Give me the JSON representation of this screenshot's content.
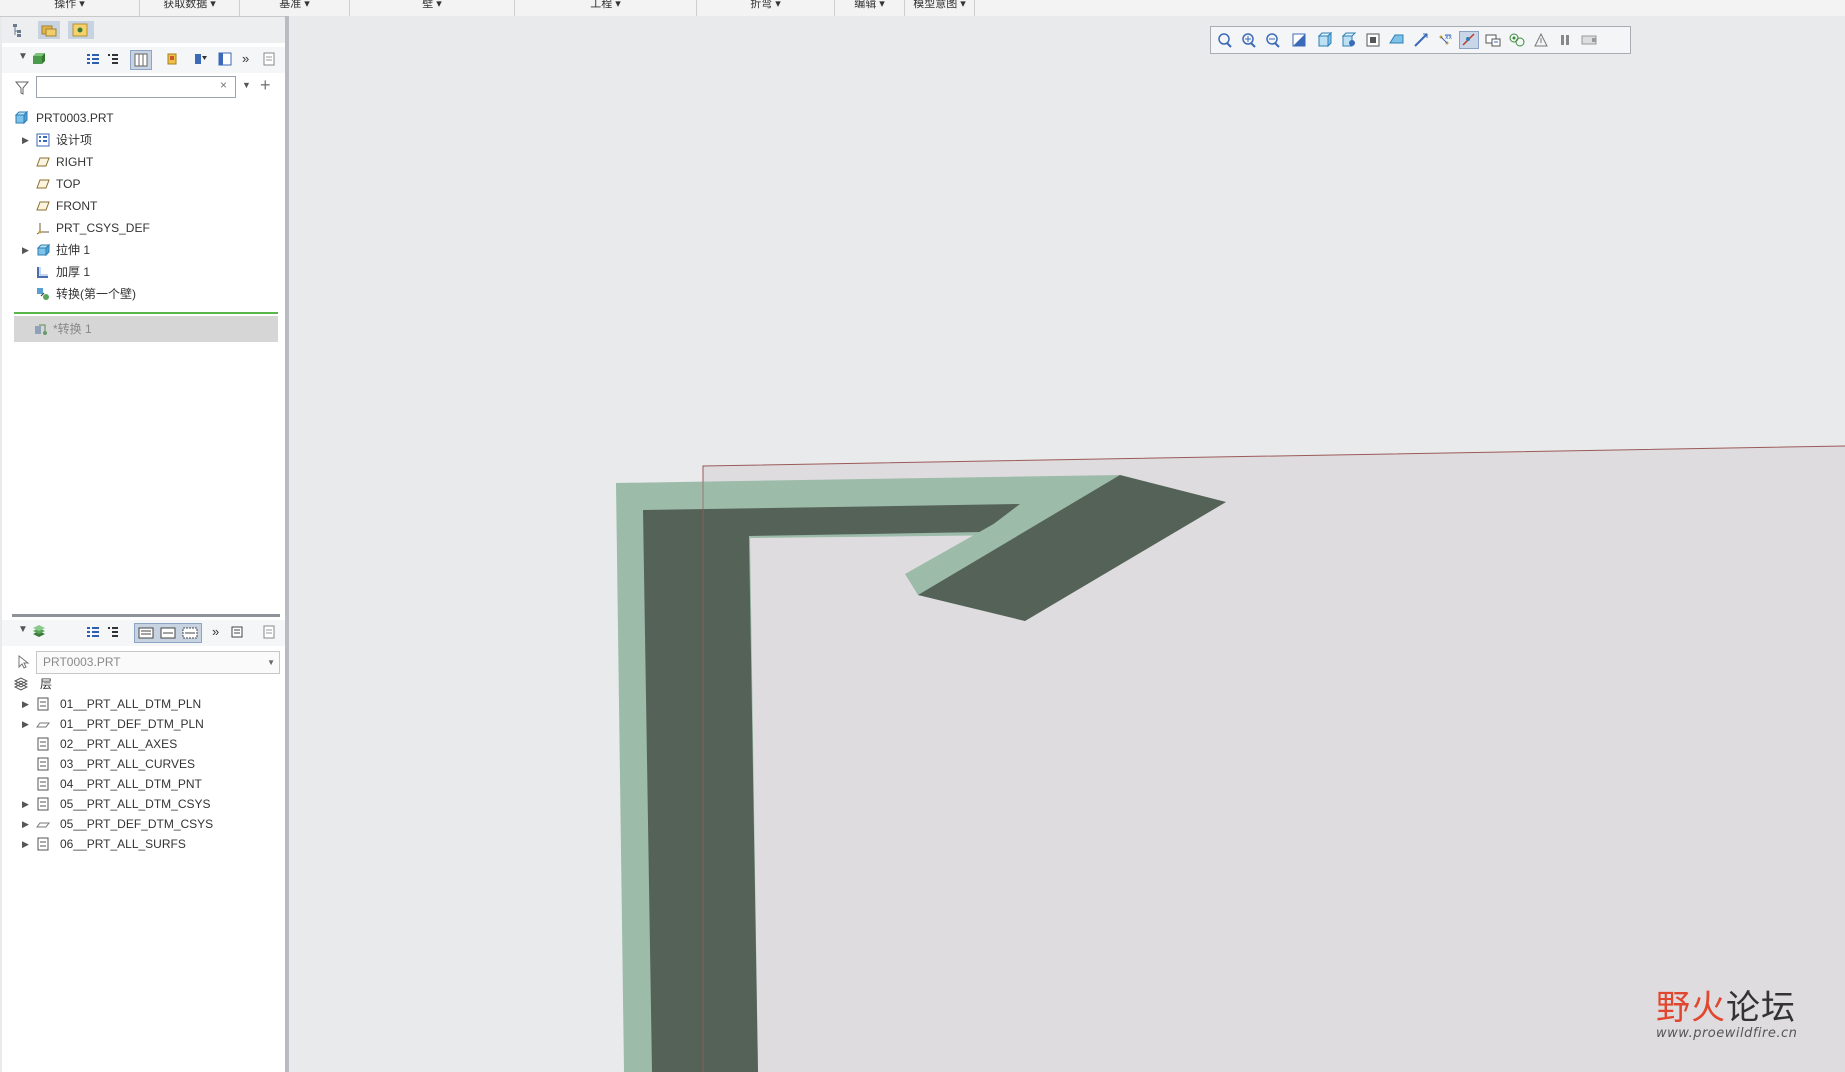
{
  "menu_groups": [
    "操作",
    "获取数据",
    "基准",
    "壁",
    "工程",
    "折弯",
    "编辑",
    "模型意图"
  ],
  "model_tree": {
    "filter_placeholder": "",
    "root": "PRT0003.PRT",
    "items": [
      {
        "label": "设计项",
        "expandable": true,
        "icon": "design-items-icon"
      },
      {
        "label": "RIGHT",
        "expandable": false,
        "icon": "datum-plane-icon"
      },
      {
        "label": "TOP",
        "expandable": false,
        "icon": "datum-plane-icon"
      },
      {
        "label": "FRONT",
        "expandable": false,
        "icon": "datum-plane-icon"
      },
      {
        "label": "PRT_CSYS_DEF",
        "expandable": false,
        "icon": "csys-icon"
      },
      {
        "label": "拉伸 1",
        "expandable": true,
        "icon": "extrude-icon"
      },
      {
        "label": "加厚 1",
        "expandable": false,
        "icon": "thicken-icon"
      },
      {
        "label": "转换(第一个壁)",
        "expandable": false,
        "icon": "convert-icon"
      }
    ],
    "inserted_feature": "转换 1"
  },
  "layer_tree": {
    "model": "PRT0003.PRT",
    "header": "层",
    "items": [
      {
        "label": "01__PRT_ALL_DTM_PLN",
        "expandable": true
      },
      {
        "label": "01__PRT_DEF_DTM_PLN",
        "expandable": true
      },
      {
        "label": "02__PRT_ALL_AXES",
        "expandable": false
      },
      {
        "label": "03__PRT_ALL_CURVES",
        "expandable": false
      },
      {
        "label": "04__PRT_ALL_DTM_PNT",
        "expandable": false
      },
      {
        "label": "05__PRT_ALL_DTM_CSYS",
        "expandable": true
      },
      {
        "label": "05__PRT_DEF_DTM_CSYS",
        "expandable": true
      },
      {
        "label": "06__PRT_ALL_SURFS",
        "expandable": true
      }
    ]
  },
  "view_toolbar": [
    "refit-icon",
    "zoom-in-icon",
    "zoom-out-icon",
    "repaint-icon",
    "display-style-icon",
    "saved-orientations-icon",
    "view-manager-icon",
    "perspective-icon",
    "datum-display-icon",
    "annotation-display-icon",
    "spin-center-icon",
    "datum-planes-icon",
    "csys-display-icon",
    "model-tree-display-icon",
    "appearance-icon",
    "pause-icon",
    "section-icon"
  ],
  "watermark": {
    "text": "野火论坛",
    "url": "www.proewildfire.cn"
  },
  "colors": {
    "sheet_dark": "#556258",
    "sheet_light": "#9dbaa8",
    "surface": "#dedede",
    "background": "#e9eaec",
    "insert_line": "#5ab54a"
  }
}
